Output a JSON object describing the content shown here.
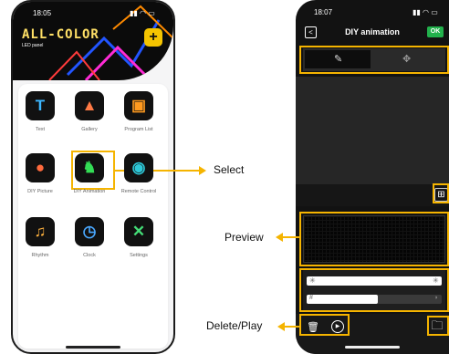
{
  "left_phone": {
    "status_time": "18:05",
    "logo": "ALL-COLOR",
    "logo_sub": "LED panel",
    "apps": [
      {
        "label": "Text",
        "icon": "text-icon",
        "glyph": "T",
        "color": "#3db7ff"
      },
      {
        "label": "Gallery",
        "icon": "gallery-icon",
        "glyph": "▲",
        "color": "#ff7a45"
      },
      {
        "label": "Program List",
        "icon": "tv-icon",
        "glyph": "▣",
        "color": "#ff9a1f"
      },
      {
        "label": "DIY Picture",
        "icon": "palette-icon",
        "glyph": "●",
        "color": "#ff6a3d"
      },
      {
        "label": "DIY Animation",
        "icon": "runner-icon",
        "glyph": "♞",
        "color": "#33dd55"
      },
      {
        "label": "Remote Control",
        "icon": "gamepad-icon",
        "glyph": "◉",
        "color": "#2ec8d8"
      },
      {
        "label": "Rhythm",
        "icon": "music-icon",
        "glyph": "♫",
        "color": "#ffb23e"
      },
      {
        "label": "Clock",
        "icon": "clock-icon",
        "glyph": "◷",
        "color": "#4aa8ff"
      },
      {
        "label": "Settings",
        "icon": "wrench-icon",
        "glyph": "✕",
        "color": "#44dd77"
      }
    ]
  },
  "right_phone": {
    "status_time": "18:07",
    "title": "DIY animation",
    "ok_label": "OK",
    "back_glyph": "<",
    "pencil_glyph": "✎",
    "move_glyph": "✥",
    "grid_glyph": "⊞",
    "brightness_glyph": "✳",
    "speed_glyph": "#",
    "trash_glyph": "🗑",
    "play_glyph": "▶",
    "folder_glyph": "🗀"
  },
  "callouts": {
    "select": "Select",
    "preview": "Preview",
    "delete_play": "Delete/Play"
  },
  "colors": {
    "highlight": "#f5b400",
    "ok_green": "#22b14c",
    "logo_yellow": "#ffe066"
  }
}
